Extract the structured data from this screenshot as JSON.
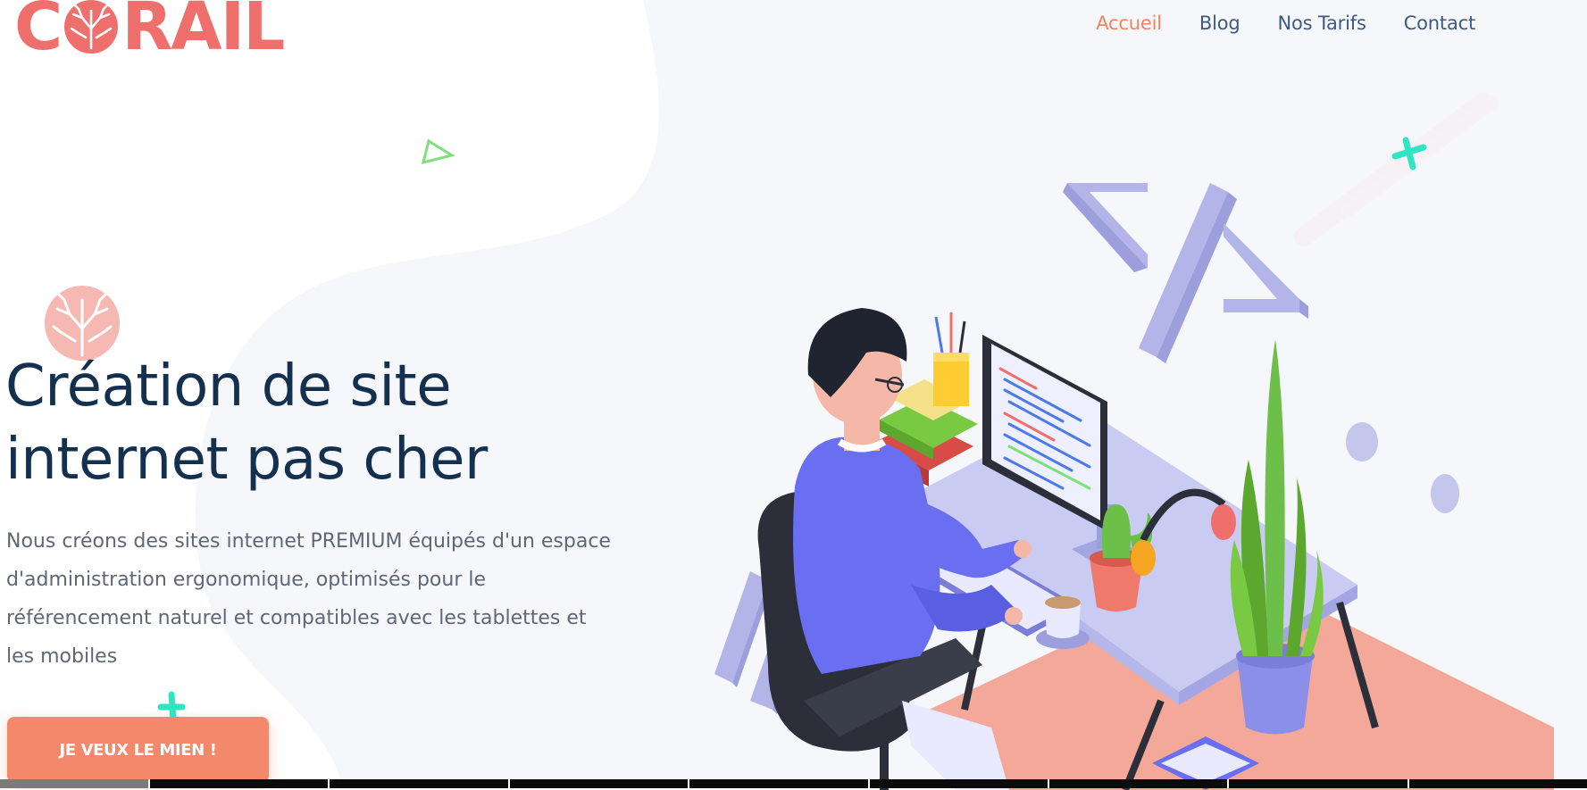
{
  "brand": {
    "name": "CORAIL",
    "logo_prefix": "C",
    "logo_suffix": "RAIL",
    "color": "#ef6f6c"
  },
  "nav": {
    "items": [
      {
        "label": "Accueil",
        "active": true
      },
      {
        "label": "Blog",
        "active": false
      },
      {
        "label": "Nos Tarifs",
        "active": false
      },
      {
        "label": "Contact",
        "active": false
      }
    ]
  },
  "hero": {
    "title_line1": "Création de site",
    "title_line2": "internet pas cher",
    "description": "Nous créons des sites internet PREMIUM équipés d'un espace d'administration ergonomique, optimisés pour le référencement naturel et compatibles avec les tablettes et les mobiles",
    "cta_label": "JE VEUX LE MIEN !"
  },
  "colors": {
    "accent": "#f2845e",
    "cta": "#f4886a",
    "title": "#14304f",
    "nav": "#3d5a80",
    "teal": "#2ee6c2",
    "green": "#7ee07a",
    "lavender": "#b3b5e8"
  },
  "icons": {
    "coral": "coral-icon",
    "triangle": "triangle-outline-icon",
    "cross": "cross-icon"
  }
}
